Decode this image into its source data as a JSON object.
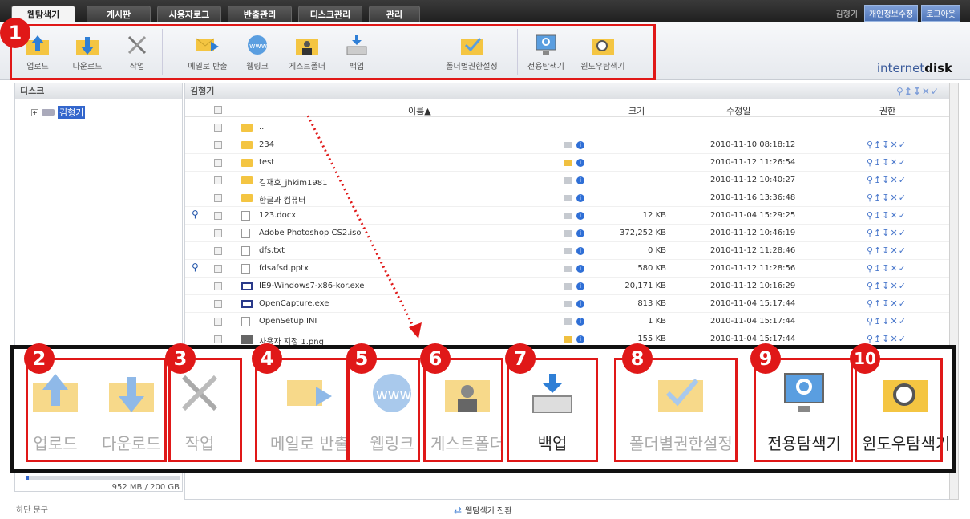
{
  "tabs": [
    {
      "label": "웹탐색기",
      "active": true
    },
    {
      "label": "게시판"
    },
    {
      "label": "사용자로그"
    },
    {
      "label": "반출관리"
    },
    {
      "label": "디스크관리"
    },
    {
      "label": "관리"
    }
  ],
  "user": {
    "name": "김형기",
    "profile_btn": "개인정보수정",
    "logout_btn": "로그아웃"
  },
  "toolbar": {
    "upload": "업로드",
    "download": "다운로드",
    "work": "작업",
    "mail_export": "메일로 반출",
    "weblink": "웹링크",
    "guest_folder": "게스트폴더",
    "backup": "백업",
    "folder_perm": "폴더별권한설정",
    "dedicated_explorer": "전용탐색기",
    "windows_explorer": "윈도우탐색기"
  },
  "brand": {
    "a": "internet",
    "b": "disk"
  },
  "left_panel": {
    "title": "디스크",
    "tree_root": "김형기"
  },
  "main_panel": {
    "title": "김형기",
    "perm_icons": "⚲↥↧✕✓",
    "columns": {
      "name": "이름▲",
      "size": "크기",
      "modified": "수정일",
      "perm": "권한"
    },
    "rows": [
      {
        "name": "..",
        "type": "folder",
        "size": "",
        "date": "",
        "mag": false,
        "box": "",
        "info": false,
        "perm": ""
      },
      {
        "name": "234",
        "type": "folder-user",
        "size": "",
        "date": "2010-11-10 08:18:12",
        "mag": false,
        "box": "g",
        "info": true,
        "perm": "⚲↥↧✕✓"
      },
      {
        "name": "test",
        "type": "folder",
        "size": "",
        "date": "2010-11-12 11:26:54",
        "mag": false,
        "box": "y",
        "info": true,
        "perm": "⚲↥↧✕✓"
      },
      {
        "name": "김재호_jhkim1981",
        "type": "folder",
        "size": "",
        "date": "2010-11-12 10:40:27",
        "mag": false,
        "box": "g",
        "info": true,
        "perm": "⚲↥↧✕✓"
      },
      {
        "name": "한글과 컴퓨터",
        "type": "folder",
        "size": "",
        "date": "2010-11-16 13:36:48",
        "mag": false,
        "box": "g",
        "info": true,
        "perm": "⚲↥↧✕✓"
      },
      {
        "name": "123.docx",
        "type": "doc",
        "size": "12 KB",
        "date": "2010-11-04 15:29:25",
        "mag": true,
        "box": "g",
        "info": true,
        "perm": "⚲↥↧✕✓"
      },
      {
        "name": "Adobe Photoshop CS2.iso",
        "type": "doc",
        "size": "372,252 KB",
        "date": "2010-11-12 10:46:19",
        "mag": false,
        "box": "g",
        "info": true,
        "perm": "⚲↥↧✕✓"
      },
      {
        "name": "dfs.txt",
        "type": "doc",
        "size": "0 KB",
        "date": "2010-11-12 11:28:46",
        "mag": false,
        "box": "g",
        "info": true,
        "perm": "⚲↥↧✕✓"
      },
      {
        "name": "fdsafsd.pptx",
        "type": "doc",
        "size": "580 KB",
        "date": "2010-11-12 11:28:56",
        "mag": true,
        "box": "g",
        "info": true,
        "perm": "⚲↥↧✕✓"
      },
      {
        "name": "IE9-Windows7-x86-kor.exe",
        "type": "exe",
        "size": "20,171 KB",
        "date": "2010-11-12 10:16:29",
        "mag": false,
        "box": "g",
        "info": true,
        "perm": "⚲↥↧✕✓"
      },
      {
        "name": "OpenCapture.exe",
        "type": "exe",
        "size": "813 KB",
        "date": "2010-11-04 15:17:44",
        "mag": false,
        "box": "g",
        "info": true,
        "perm": "⚲↥↧✕✓"
      },
      {
        "name": "OpenSetup.INI",
        "type": "doc",
        "size": "1 KB",
        "date": "2010-11-04 15:17:44",
        "mag": false,
        "box": "g",
        "info": true,
        "perm": "⚲↥↧✕✓"
      },
      {
        "name": "사용자 지정 1.png",
        "type": "img",
        "size": "155 KB",
        "date": "2010-11-04 15:17:44",
        "mag": false,
        "box": "y",
        "info": true,
        "perm": "⚲↥↧✕✓"
      }
    ]
  },
  "quota": {
    "text": "952 MB / 200 GB",
    "used_fraction": 0.005
  },
  "footer": {
    "left": "하단 문구",
    "switch": "웹탐색기 전환"
  },
  "badges": [
    "1",
    "2",
    "3",
    "4",
    "5",
    "6",
    "7",
    "8",
    "9",
    "10"
  ],
  "zoom_labels": {
    "upload": "업로드",
    "download": "다운로드",
    "work": "작업",
    "mail_export": "메일로 반출",
    "weblink": "웹링크",
    "guest_folder": "게스트폴더",
    "backup": "백업",
    "folder_perm": "폴더별권한설정",
    "dedicated_explorer": "전용탐색기",
    "windows_explorer": "윈도우탐색기"
  }
}
